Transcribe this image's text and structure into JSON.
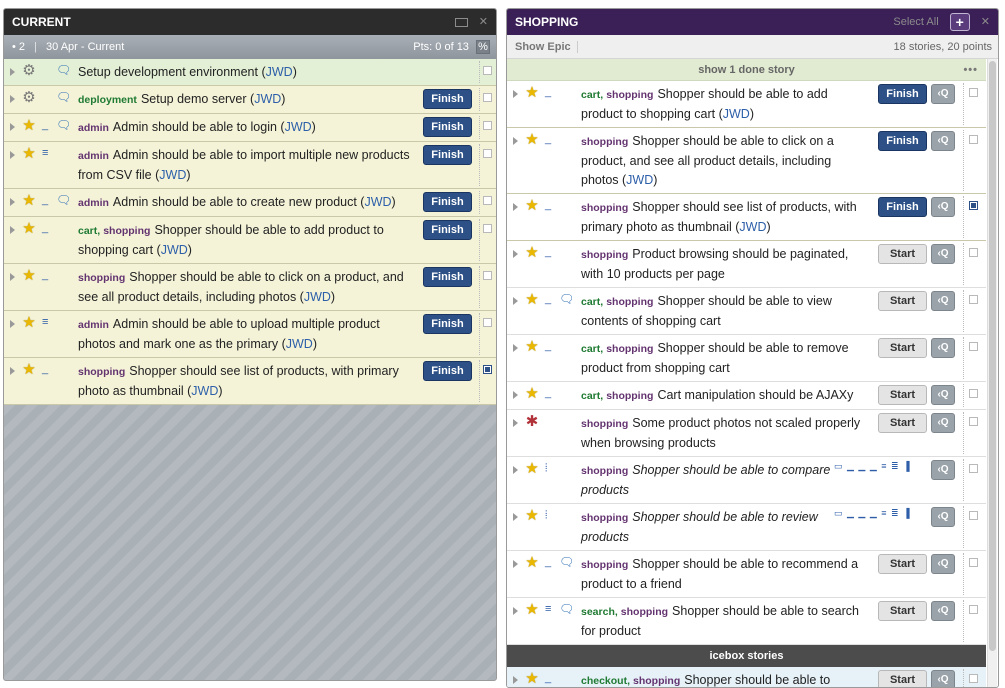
{
  "current": {
    "title": "CURRENT",
    "ctrl_close": "✕",
    "iteration_num": "• 2",
    "iteration_date": "30 Apr - Current",
    "points": "Pts: 0 of 13",
    "points_pct": "%",
    "stories": [
      {
        "type": "chore-icon",
        "sym": "⚙",
        "cmt": true,
        "est": "",
        "labels": [],
        "text": "Setup development environment (",
        "owner": "JWD",
        "action": "",
        "checked": false,
        "accepted": true
      },
      {
        "type": "chore-icon",
        "sym": "⚙",
        "cmt": true,
        "est": "",
        "labels": [
          {
            "t": "deployment",
            "c": "green"
          }
        ],
        "text": "Setup demo server (",
        "owner": "JWD",
        "action": "Finish",
        "checked": false,
        "accepted": false
      },
      {
        "type": "star-icon",
        "sym": "★",
        "cmt": true,
        "est": "_",
        "labels": [
          {
            "t": "admin",
            "c": "purple"
          }
        ],
        "text": "Admin should be able to login (",
        "owner": "JWD",
        "action": "Finish",
        "checked": false,
        "accepted": false
      },
      {
        "type": "star-icon",
        "sym": "★",
        "cmt": false,
        "est": "≡",
        "labels": [
          {
            "t": "admin",
            "c": "purple"
          }
        ],
        "text": "Admin should be able to import multiple new products from CSV file (",
        "owner": "JWD",
        "action": "Finish",
        "checked": false,
        "accepted": false
      },
      {
        "type": "star-icon",
        "sym": "★",
        "cmt": true,
        "est": "_",
        "labels": [
          {
            "t": "admin",
            "c": "purple"
          }
        ],
        "text": "Admin should be able to create new product (",
        "owner": "JWD",
        "action": "Finish",
        "checked": false,
        "accepted": false
      },
      {
        "type": "star-icon",
        "sym": "★",
        "cmt": false,
        "est": "_",
        "labels": [
          {
            "t": "cart,",
            "c": "green"
          },
          {
            "t": "shopping",
            "c": "purple"
          }
        ],
        "text": "Shopper should be able to add product to shopping cart (",
        "owner": "JWD",
        "action": "Finish",
        "checked": false,
        "accepted": false
      },
      {
        "type": "star-icon",
        "sym": "★",
        "cmt": false,
        "est": "_",
        "labels": [
          {
            "t": "shopping",
            "c": "purple"
          }
        ],
        "text": "Shopper should be able to click on a product, and see all product details, including photos (",
        "owner": "JWD",
        "action": "Finish",
        "checked": false,
        "accepted": false
      },
      {
        "type": "star-icon",
        "sym": "★",
        "cmt": false,
        "est": "≡",
        "labels": [
          {
            "t": "admin",
            "c": "purple"
          }
        ],
        "text": "Admin should be able to upload multiple product photos and mark one as the primary (",
        "owner": "JWD",
        "action": "Finish",
        "checked": false,
        "accepted": false
      },
      {
        "type": "star-icon",
        "sym": "★",
        "cmt": false,
        "est": "_",
        "labels": [
          {
            "t": "shopping",
            "c": "purple"
          }
        ],
        "text": "Shopper should see list of products, with primary photo as thumbnail (",
        "owner": "JWD",
        "action": "Finish",
        "checked": true,
        "accepted": false
      }
    ]
  },
  "shopping": {
    "title": "SHOPPING",
    "select_all": "Select All",
    "add": "+",
    "close": "✕",
    "show_epic": "Show Epic",
    "summary": "18 stories, 20 points",
    "done_toggle": "show 1 done story",
    "done_menu": "•••",
    "icebox_label": "icebox stories",
    "stories": [
      {
        "type": "star-icon",
        "sym": "★",
        "cmt": false,
        "est": "_",
        "labels": [
          {
            "t": "cart,",
            "c": "green"
          },
          {
            "t": "shopping",
            "c": "purple"
          }
        ],
        "text": "Shopper should be able to add product to shopping cart (",
        "owner": "JWD",
        "action": "Finish",
        "checked": false,
        "state": "started",
        "italic": false
      },
      {
        "type": "star-icon",
        "sym": "★",
        "cmt": false,
        "est": "_",
        "labels": [
          {
            "t": "shopping",
            "c": "purple"
          }
        ],
        "text": "Shopper should be able to click on a product, and see all product details, including photos (",
        "owner": "JWD",
        "action": "Finish",
        "checked": false,
        "state": "started",
        "italic": false
      },
      {
        "type": "star-icon",
        "sym": "★",
        "cmt": false,
        "est": "_",
        "labels": [
          {
            "t": "shopping",
            "c": "purple"
          }
        ],
        "text": "Shopper should see list of products, with primary photo as thumbnail (",
        "owner": "JWD",
        "action": "Finish",
        "checked": true,
        "state": "started",
        "italic": false
      },
      {
        "type": "star-icon",
        "sym": "★",
        "cmt": false,
        "est": "_",
        "labels": [
          {
            "t": "shopping",
            "c": "purple"
          }
        ],
        "text": "Product browsing should be paginated, with 10 products per page",
        "owner": "",
        "action": "Start",
        "checked": false,
        "state": "unstarted",
        "italic": false
      },
      {
        "type": "star-icon",
        "sym": "★",
        "cmt": true,
        "est": "_",
        "labels": [
          {
            "t": "cart,",
            "c": "green"
          },
          {
            "t": "shopping",
            "c": "purple"
          }
        ],
        "text": "Shopper should be able to view contents of shopping cart",
        "owner": "",
        "action": "Start",
        "checked": false,
        "state": "unstarted",
        "italic": false
      },
      {
        "type": "star-icon",
        "sym": "★",
        "cmt": false,
        "est": "_",
        "labels": [
          {
            "t": "cart,",
            "c": "green"
          },
          {
            "t": "shopping",
            "c": "purple"
          }
        ],
        "text": "Shopper should be able to remove product from shopping cart",
        "owner": "",
        "action": "Start",
        "checked": false,
        "state": "unstarted",
        "italic": false
      },
      {
        "type": "star-icon",
        "sym": "★",
        "cmt": false,
        "est": "_",
        "labels": [
          {
            "t": "cart,",
            "c": "green"
          },
          {
            "t": "shopping",
            "c": "purple"
          }
        ],
        "text": "Cart manipulation should be AJAXy",
        "owner": "",
        "action": "Start",
        "checked": false,
        "state": "unstarted",
        "italic": false
      },
      {
        "type": "bug-icon",
        "sym": "✱",
        "cmt": false,
        "est": "",
        "labels": [
          {
            "t": "shopping",
            "c": "purple"
          }
        ],
        "text": "Some product photos not scaled properly when browsing products",
        "owner": "",
        "action": "Start",
        "checked": false,
        "state": "unstarted",
        "italic": false
      },
      {
        "type": "star-icon",
        "sym": "★",
        "cmt": false,
        "est": "⦙",
        "labels": [
          {
            "t": "shopping",
            "c": "purple"
          }
        ],
        "text": "Shopper should be able to compare products",
        "owner": "",
        "action": "",
        "estimate_scale": "▭ ▁ ▁ ▁ ≡ ≣ ▐",
        "checked": false,
        "state": "unstarted",
        "italic": true
      },
      {
        "type": "star-icon",
        "sym": "★",
        "cmt": false,
        "est": "⦙",
        "labels": [
          {
            "t": "shopping",
            "c": "purple"
          }
        ],
        "text": "Shopper should be able to review products",
        "owner": "",
        "action": "",
        "estimate_scale": "▭ ▁ ▁ ▁ ≡ ≣ ▐",
        "checked": false,
        "state": "unstarted",
        "italic": true
      },
      {
        "type": "star-icon",
        "sym": "★",
        "cmt": true,
        "est": "_",
        "labels": [
          {
            "t": "shopping",
            "c": "purple"
          }
        ],
        "text": "Shopper should be able to recommend a product to a friend",
        "owner": "",
        "action": "Start",
        "checked": false,
        "state": "unstarted",
        "italic": false
      },
      {
        "type": "star-icon",
        "sym": "★",
        "cmt": true,
        "est": "≡",
        "labels": [
          {
            "t": "search,",
            "c": "green"
          },
          {
            "t": "shopping",
            "c": "purple"
          }
        ],
        "text": "Shopper should be able to search for product",
        "owner": "",
        "action": "Start",
        "checked": false,
        "state": "unstarted",
        "italic": false
      }
    ],
    "icebox_stories": [
      {
        "type": "star-icon",
        "sym": "★",
        "cmt": false,
        "est": "_",
        "labels": [
          {
            "t": "checkout,",
            "c": "green"
          },
          {
            "t": "shopping",
            "c": "purple"
          }
        ],
        "text": "Shopper should be able to enter credit card information and shipping address",
        "owner": "",
        "action": "Start",
        "checked": false,
        "state": "icebox",
        "italic": false
      }
    ]
  }
}
